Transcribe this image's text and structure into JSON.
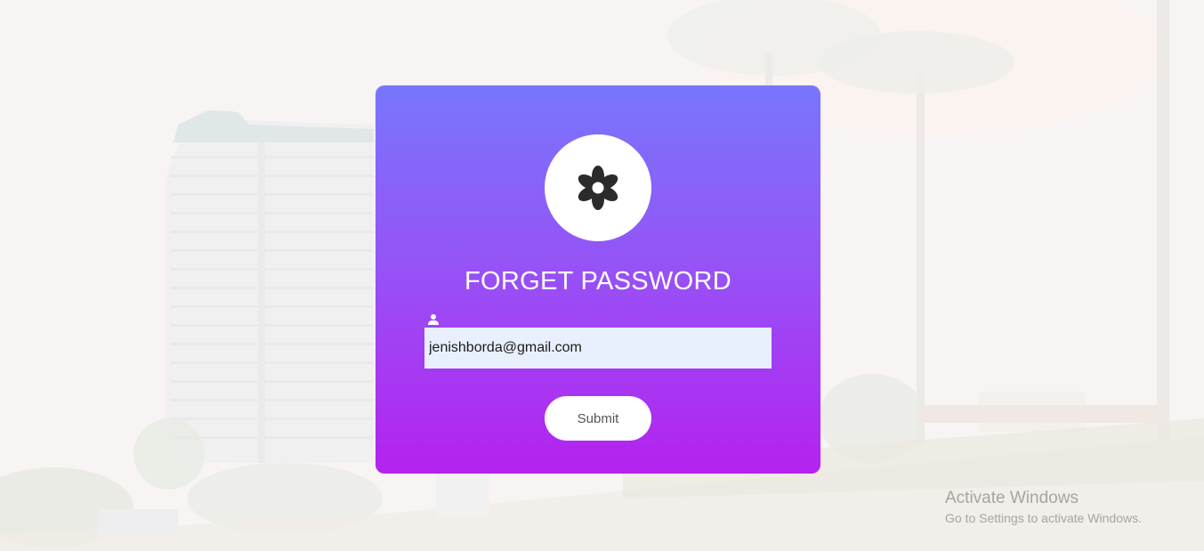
{
  "form": {
    "title": "FORGET PASSWORD",
    "email": {
      "value": "jenishborda@gmail.com",
      "label_icon": "user-icon"
    },
    "submit_label": "Submit"
  },
  "logo": {
    "icon": "flower-icon"
  },
  "watermark": {
    "title": "Activate Windows",
    "subtitle": "Go to Settings to activate Windows."
  },
  "colors": {
    "card_gradient_top": "#7876fd",
    "card_gradient_bottom": "#b422ef",
    "input_background": "#e8f0fe",
    "button_background": "#ffffff",
    "logo_background": "#ffffff"
  }
}
